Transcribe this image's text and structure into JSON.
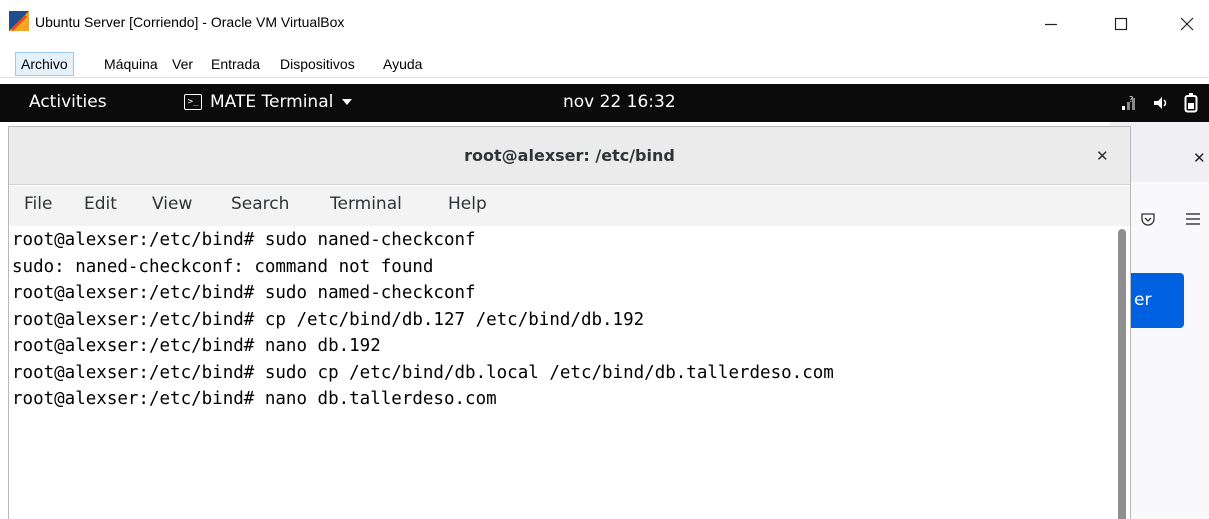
{
  "window": {
    "title": "Ubuntu Server [Corriendo] - Oracle VM VirtualBox"
  },
  "vbox_menu": {
    "items": [
      "Archivo",
      "Máquina",
      "Ver",
      "Entrada",
      "Dispositivos",
      "Ayuda"
    ]
  },
  "gnome_bar": {
    "activities": "Activities",
    "app_name": "MATE Terminal",
    "clock": "nov 22 16:32"
  },
  "terminal": {
    "title": "root@alexser: /etc/bind",
    "menu": [
      "File",
      "Edit",
      "View",
      "Search",
      "Terminal",
      "Help"
    ],
    "lines": [
      "root@alexser:/etc/bind# sudo naned-checkconf",
      "sudo: naned-checkconf: command not found",
      "root@alexser:/etc/bind# sudo named-checkconf",
      "root@alexser:/etc/bind# cp /etc/bind/db.127 /etc/bind/db.192",
      "root@alexser:/etc/bind# nano db.192",
      "root@alexser:/etc/bind# sudo cp /etc/bind/db.local /etc/bind/db.tallerdeso.com",
      "root@alexser:/etc/bind# nano db.tallerdeso.com"
    ]
  },
  "background_browser": {
    "button_fragment": "er"
  },
  "colors": {
    "gnome_bar": "#0b0b0b",
    "accent_blue": "#0061e0",
    "vbox_active_menu": "#e5f1fb"
  }
}
